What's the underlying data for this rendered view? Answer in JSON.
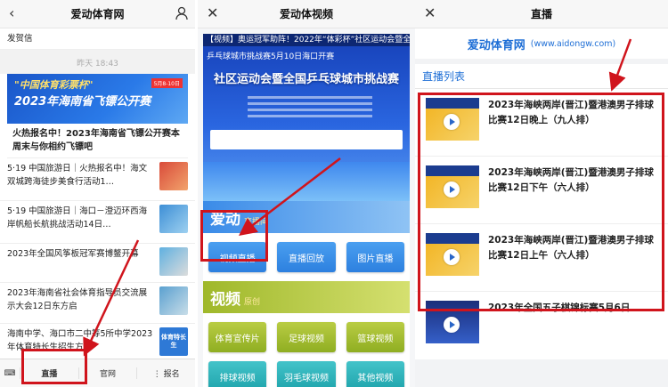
{
  "panel1": {
    "title": "爱动体育网",
    "top_text": "发贺信",
    "timestamp": "昨天 18:43",
    "banner": {
      "line1": "\"中国体育彩票杯\"",
      "line2": "2023年海南省飞镖公开赛",
      "badge": "5月8-10日"
    },
    "headline": "火热报名中！2023年海南省飞镖公开赛本周末与你相约飞镖吧",
    "articles": [
      "5·19 中国旅游日｜火热报名中！海文双城跨海徒步美食行活动1…",
      "5·19 中国旅游日｜海口－澄迈环西海岸帆船长航挑战活动14日…",
      "2023年全国风筝板冠军赛博鳌开幕",
      "2023年海南省社会体育指导员交流展示大会12日东方启",
      "海南中学、海口市二中等5所中学2023年体育特长生招生方案"
    ],
    "thumb_label": "体育特长生",
    "tabs": [
      "直播",
      "官网",
      "报名"
    ]
  },
  "panel2": {
    "title": "爱动体视频",
    "ticker": "【视频】奥运冠军助阵！2022年“体彩杯”社区运动会暨全国",
    "subticker": "乒乓球城市挑战赛5月10日海口开赛",
    "poster_title": "社区运动会暨全国乒乓球城市挑战赛",
    "section1": {
      "title": "爱动",
      "subtitle": "直播间"
    },
    "row1": [
      "视频直播",
      "直播回放",
      "图片直播"
    ],
    "section2": {
      "title": "视频",
      "subtitle": "原创"
    },
    "row2": [
      "体育宣传片",
      "足球视频",
      "篮球视频"
    ],
    "row3": [
      "排球视频",
      "羽毛球视频",
      "其他视频"
    ]
  },
  "panel3": {
    "title": "直播",
    "brand_name": "爱动体育网",
    "brand_url": "(www.aidongw.com)",
    "list_header": "直播列表",
    "videos": [
      "2023年海峡两岸(晋江)暨港澳男子排球比赛12日晚上（九人排）",
      "2023年海峡两岸(晋江)暨港澳男子排球比赛12日下午（六人排）",
      "2023年海峡两岸(晋江)暨港澳男子排球比赛12日上午（六人排）",
      "2023年全国五子棋锦标赛5月6日"
    ]
  },
  "colors": {
    "accent_red": "#d0141c",
    "link_blue": "#1f6fd6"
  }
}
